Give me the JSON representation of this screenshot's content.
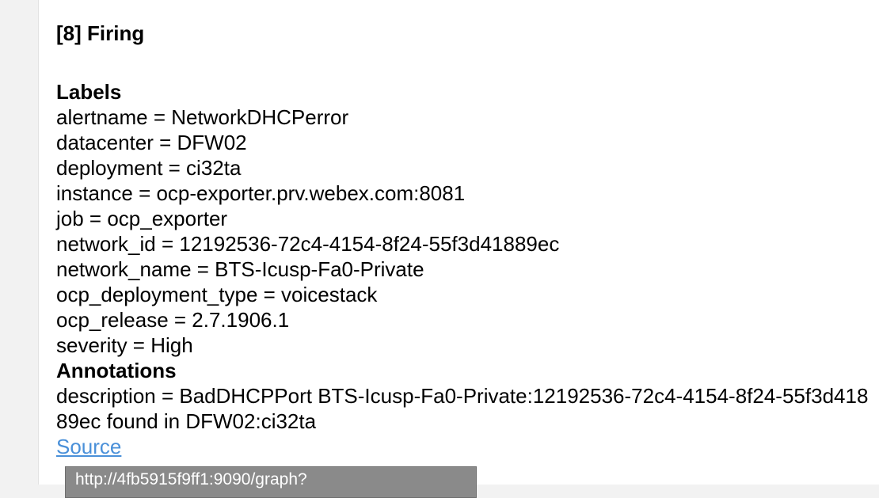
{
  "alert": {
    "header": "[8] Firing"
  },
  "labels": {
    "heading": "Labels",
    "items": [
      "alertname = NetworkDHCPerror",
      "datacenter = DFW02",
      "deployment = ci32ta",
      "instance = ocp-exporter.prv.webex.com:8081",
      "job = ocp_exporter",
      "network_id = 12192536-72c4-4154-8f24-55f3d41889ec",
      "network_name = BTS-Icusp-Fa0-Private",
      "ocp_deployment_type = voicestack",
      "ocp_release = 2.7.1906.1",
      "severity = High"
    ]
  },
  "annotations": {
    "heading": "Annotations",
    "description": "description = BadDHCPPort BTS-Icusp-Fa0-Private:12192536-72c4-4154-8f24-55f3d41889ec found in DFW02:ci32ta"
  },
  "source": {
    "label": "Source"
  },
  "tooltip": {
    "text": "http://4fb5915f9ff1:9090/graph?"
  },
  "colors": {
    "link": "#4a90d9",
    "tooltip_bg": "#8a8a8a"
  }
}
